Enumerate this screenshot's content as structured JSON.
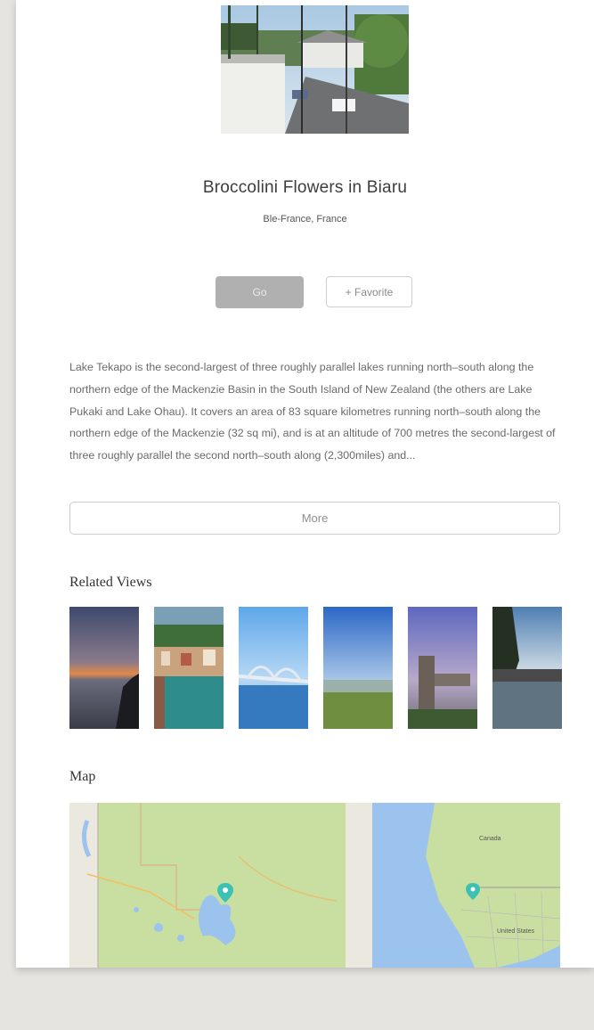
{
  "place": {
    "title": "Broccolini Flowers in Biaru",
    "subtitle": "Ble-France, France"
  },
  "actions": {
    "go_label": "Go",
    "favorite_label": "+ Favorite"
  },
  "description": "Lake Tekapo is the second-largest of three roughly parallel lakes running north–south along the northern edge of the Mackenzie Basin in the South Island of New Zealand (the others are Lake Pukaki and Lake Ohau). It covers an area of 83 square kilometres running north–south along the northern edge of the Mackenzie (32 sq mi), and is at an altitude of 700 metres the second-largest of three roughly parallel the second north–south along (2,300miles) and...",
  "more_label": "More",
  "related": {
    "heading": "Related Views",
    "items": [
      {
        "name": "sunset-lake"
      },
      {
        "name": "canal-town"
      },
      {
        "name": "bridge"
      },
      {
        "name": "field"
      },
      {
        "name": "tower"
      },
      {
        "name": "pool-trees"
      }
    ]
  },
  "map": {
    "heading": "Map",
    "label_canada": "Canada",
    "label_us": "United States"
  },
  "colors": {
    "go_button": "#b0b0b0",
    "map_land": "#c9dfa1",
    "map_water": "#9cc3ee",
    "map_pin": "#3cc1b3"
  }
}
